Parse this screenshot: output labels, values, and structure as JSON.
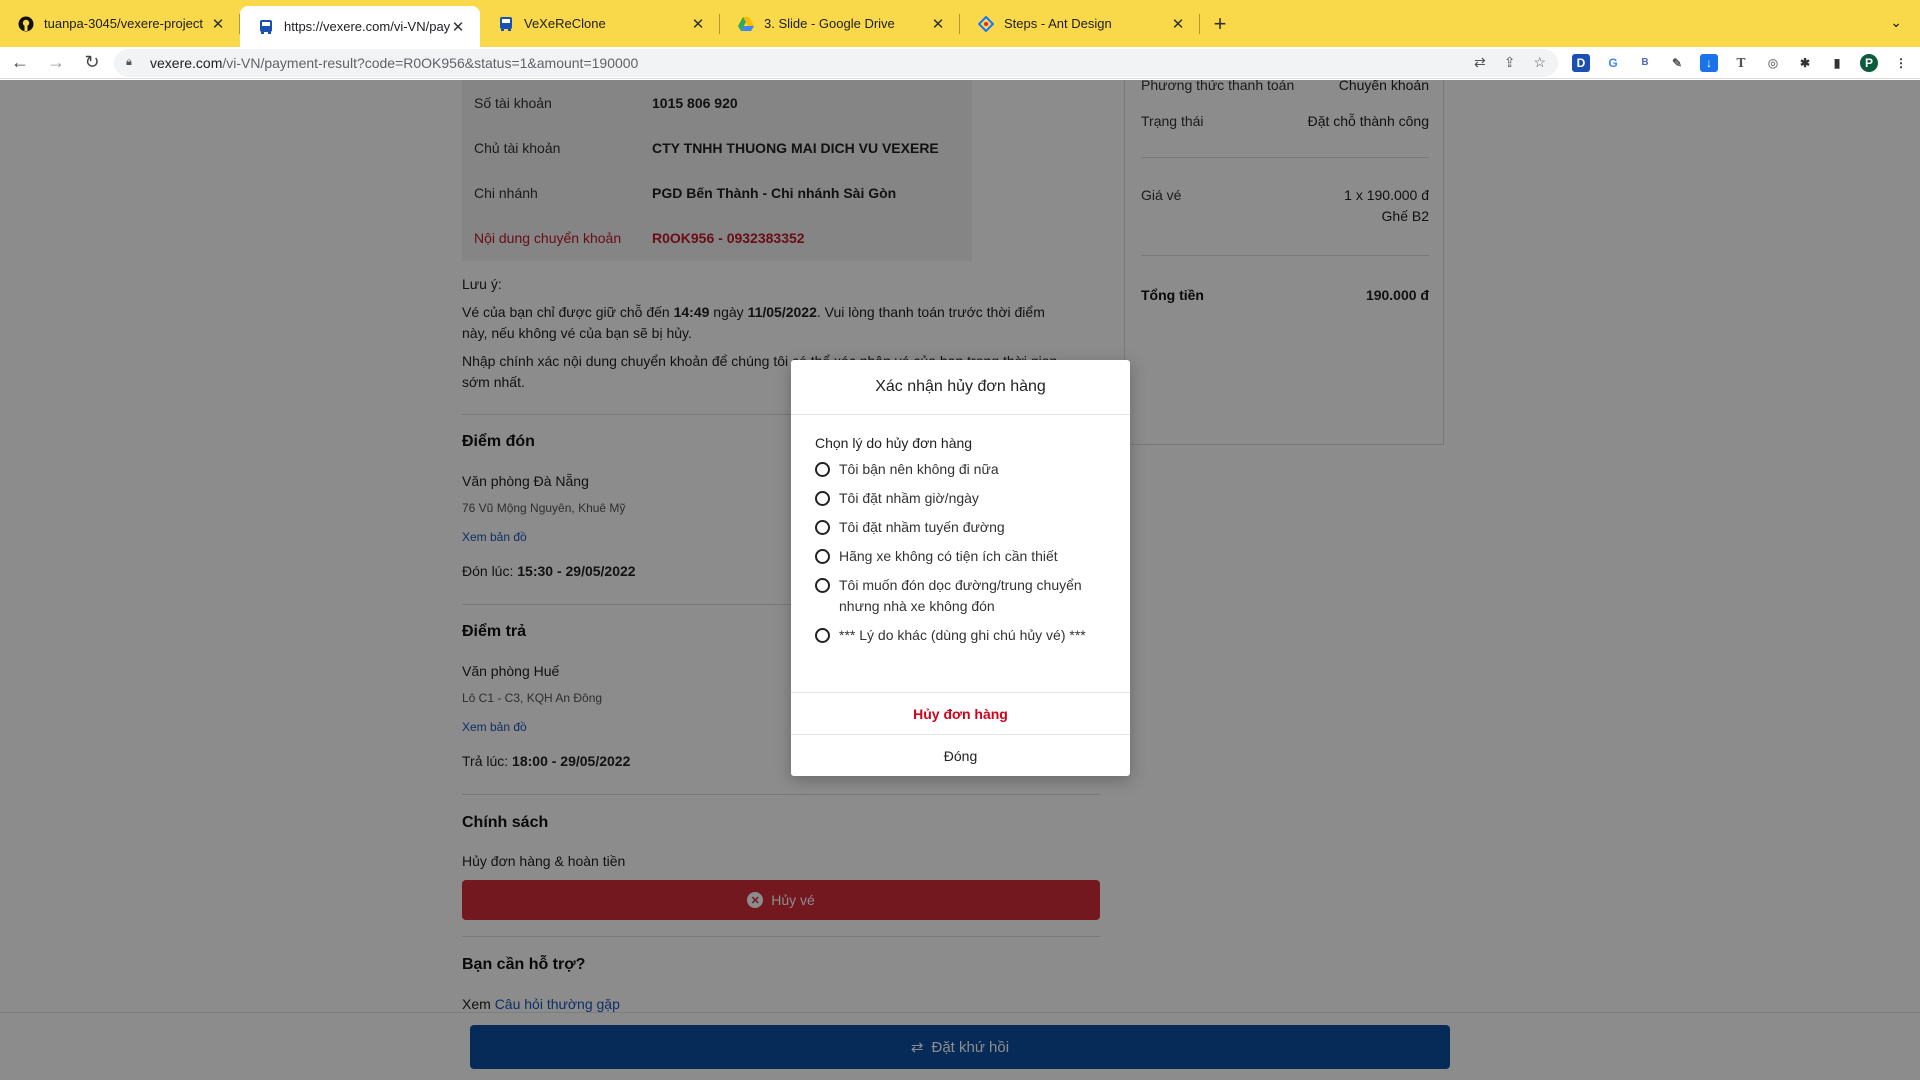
{
  "browser": {
    "tabs": [
      {
        "title": "tuanpa-3045/vexere-project",
        "icon": "github-icon",
        "active": false
      },
      {
        "title": "https://vexere.com/vi-VN/paym",
        "icon": "bus-icon",
        "active": true
      },
      {
        "title": "VeXeReClone",
        "icon": "bus-icon",
        "active": false
      },
      {
        "title": "3. Slide - Google Drive",
        "icon": "google-drive-icon",
        "active": false
      },
      {
        "title": "Steps - Ant Design",
        "icon": "ant-design-icon",
        "active": false
      }
    ],
    "url_host": "vexere.com",
    "url_rest": "/vi-VN/payment-result?code=R0OK956&status=1&amount=190000",
    "profile_initial": "P"
  },
  "bank": {
    "rows": [
      {
        "label": "Số tài khoản",
        "value": "1015 806 920"
      },
      {
        "label": "Chủ tài khoản",
        "value": "CTY TNHH THUONG MAI DICH VU VEXERE"
      },
      {
        "label": "Chi nhánh",
        "value": "PGD Bến Thành - Chi nhánh Sài Gòn"
      },
      {
        "label": "Nội dung chuyển khoản",
        "value": "R0OK956 - 0932383352"
      }
    ]
  },
  "note": {
    "title": "Lưu ý:",
    "line1_prefix": "Vé của bạn chỉ được giữ chỗ đến ",
    "time": "14:49",
    "line1_mid": " ngày ",
    "date": "11/05/2022",
    "line1_suffix": ". Vui lòng thanh toán trước thời điểm",
    "line2": "này, nếu không vé của bạn sẽ bị hủy.",
    "line3": "Nhập chính xác nội dung chuyển khoản để chúng tôi có thể xác nhận vé của bạn trong thời gian",
    "line4": "sớm nhất."
  },
  "pickup": {
    "title": "Điểm đón",
    "place": "Văn phòng Đà Nẵng",
    "address": "76 Vũ Mộng Nguyên, Khuê Mỹ",
    "map_link": "Xem bản đồ",
    "time_label": "Đón lúc: ",
    "time_value": "15:30 - 29/05/2022"
  },
  "dropoff": {
    "title": "Điểm trả",
    "place": "Văn phòng Huế",
    "address": "Lô C1 - C3, KQH An Đông",
    "map_link": "Xem bản đồ",
    "time_label": "Trả lúc: ",
    "time_value": "18:00 - 29/05/2022"
  },
  "policy": {
    "title": "Chính sách",
    "subtitle": "Hủy đơn hàng & hoàn tiền",
    "cancel_button": "Hủy vé"
  },
  "support": {
    "title": "Bạn cần hỗ trợ?",
    "prefix": "Xem ",
    "faq_link": "Câu hỏi thường gặp"
  },
  "summary": {
    "payment_method_label": "Phương thức thanh toán",
    "payment_method_value": "Chuyển khoản",
    "status_label": "Trạng thái",
    "status_value": "Đặt chỗ thành công",
    "price_label": "Giá vé",
    "price_value": "1 x 190.000 đ",
    "seat": "Ghế B2",
    "total_label": "Tổng tiền",
    "total_value": "190.000 đ"
  },
  "roundtrip_button": "Đặt khứ hồi",
  "modal": {
    "title": "Xác nhận hủy đơn hàng",
    "prompt": "Chọn lý do hủy đơn hàng",
    "options": [
      "Tôi bận nên không đi nữa",
      "Tôi đặt nhầm giờ/ngày",
      "Tôi đặt nhầm tuyến đường",
      "Hãng xe không có tiện ích cần thiết",
      "Tôi muốn đón dọc đường/trung chuyển nhưng nhà xe không đón",
      "*** Lý do khác (dùng ghi chú hủy vé) ***"
    ],
    "confirm_button": "Hủy đơn hàng",
    "close_button": "Đóng"
  },
  "colors": {
    "tabbar": "#f9d84a",
    "danger": "#d42d3b",
    "primary": "#0d4fa3",
    "link": "#1a56b8"
  }
}
